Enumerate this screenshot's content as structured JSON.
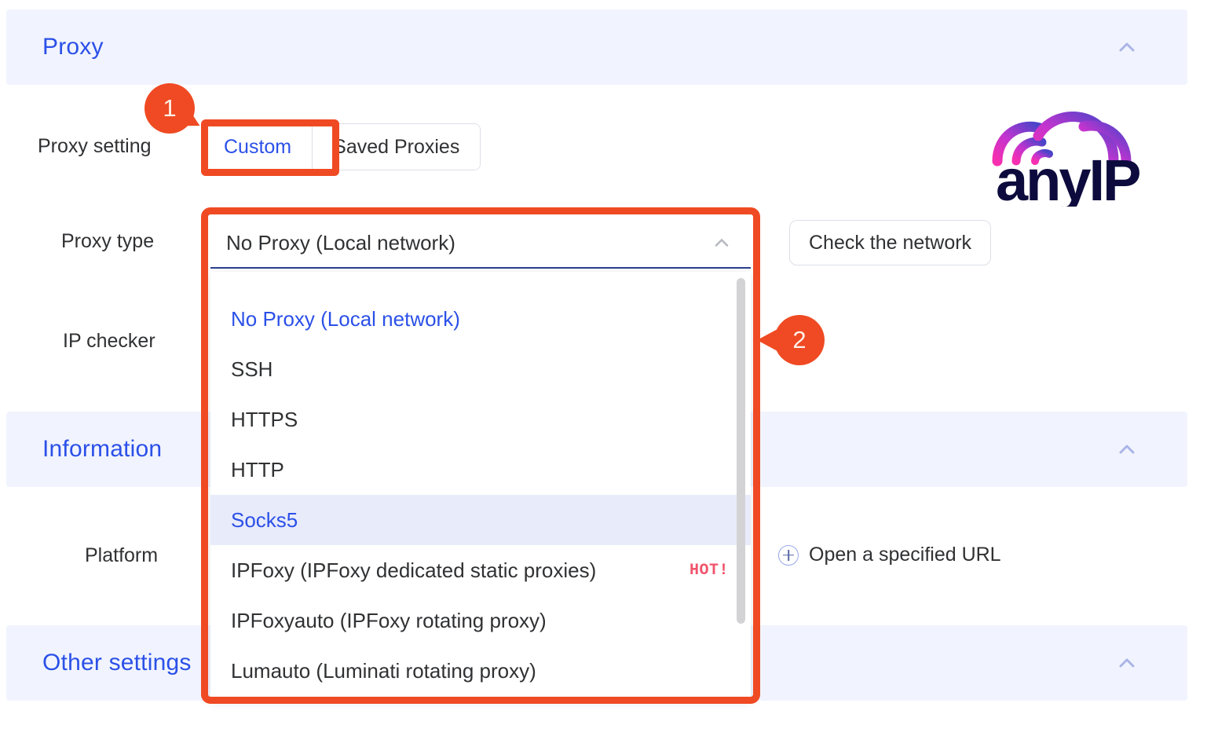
{
  "sections": [
    {
      "id": "proxy",
      "title": "Proxy",
      "chevron_icon": "chevron-up-icon"
    },
    {
      "id": "information",
      "title": "Information",
      "chevron_icon": "chevron-up-icon"
    },
    {
      "id": "other",
      "title": "Other settings",
      "chevron_icon": "chevron-up-icon"
    }
  ],
  "labels": {
    "proxy_setting": "Proxy setting",
    "proxy_type": "Proxy type",
    "ip_checker": "IP checker",
    "platform": "Platform"
  },
  "proxy_setting": {
    "options": [
      {
        "label": "Custom",
        "active": true
      },
      {
        "label": "Saved Proxies",
        "active": false
      }
    ]
  },
  "proxy_type_select": {
    "value": "No Proxy (Local network)",
    "caret_icon": "chevron-up-icon",
    "expanded": true,
    "options": [
      {
        "label": "No Proxy (Local network)",
        "state": "selected",
        "badge": ""
      },
      {
        "label": "SSH",
        "state": "normal",
        "badge": ""
      },
      {
        "label": "HTTPS",
        "state": "normal",
        "badge": ""
      },
      {
        "label": "HTTP",
        "state": "normal",
        "badge": ""
      },
      {
        "label": "Socks5",
        "state": "hovered",
        "badge": ""
      },
      {
        "label": "IPFoxy (IPFoxy dedicated static proxies)",
        "state": "normal",
        "badge": "HOT!"
      },
      {
        "label": "IPFoxyauto (IPFoxy rotating proxy)",
        "state": "normal",
        "badge": ""
      },
      {
        "label": "Lumauto (Luminati rotating proxy)",
        "state": "normal",
        "badge": ""
      }
    ]
  },
  "buttons": {
    "check_network": "Check the network",
    "open_specified_url": "Open a specified URL",
    "plus_icon": "plus-circle-icon"
  },
  "logo": {
    "text": "anyIP",
    "icon": "anyip-cloud-wifi-logo"
  },
  "annotations": [
    {
      "number": "1",
      "target": "custom-tab"
    },
    {
      "number": "2",
      "target": "proxy-type-dropdown"
    }
  ],
  "colors": {
    "accent_blue": "#2b50e8",
    "band_bg": "#f1f4fe",
    "annotation_orange": "#ef4a23",
    "hot_badge": "#f0556d",
    "hover_bg": "#e8ebfa"
  }
}
